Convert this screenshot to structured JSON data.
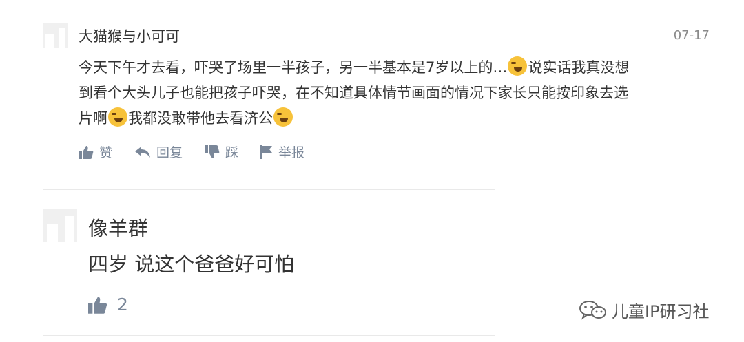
{
  "comments": [
    {
      "username": "大猫猴与小可可",
      "date": "07-17",
      "text_lines": [
        [
          "今天下午才去看，吓哭了场里一半孩子，另一半基本是7岁以上的…",
          "emoji",
          "说实话我真没想"
        ],
        [
          "到看个大头儿子也能把孩子吓哭，在不知道具体情节画面的情况下家长只能按印象去选"
        ],
        [
          "片啊",
          "emoji",
          "我都没敢带他去看济公",
          "emoji"
        ]
      ],
      "actions": {
        "like": "赞",
        "reply": "回复",
        "dislike": "踩",
        "report": "举报"
      }
    },
    {
      "username": "像羊群",
      "text": "四岁 说这个爸爸好可怕",
      "like_count": "2"
    }
  ],
  "watermark": {
    "icon": "wechat-icon",
    "text": "儿童IP研习社"
  },
  "icons": {
    "like": "thumbs-up-icon",
    "reply": "reply-arrow-icon",
    "dislike": "thumbs-down-icon",
    "report": "flag-icon",
    "emoji": "laughing-crying-emoji-icon"
  },
  "colors": {
    "action_gray": "#7a8799",
    "emoji_yellow": "#f7c23a"
  }
}
